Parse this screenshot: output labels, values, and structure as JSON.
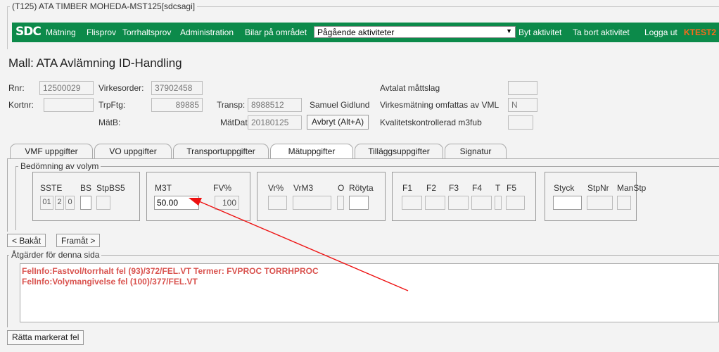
{
  "window": {
    "title": "(T125) ATA TIMBER MOHEDA-MST125[sdcsagi]"
  },
  "navbar": {
    "logo": "SDC",
    "items": [
      "Mätning",
      "Flisprov",
      "Torrhaltsprov",
      "Administration",
      "Bilar på området"
    ],
    "select_value": "Pågående aktiviteter",
    "actions": [
      "Byt aktivitet",
      "Ta bort aktivitet",
      "Logga ut"
    ],
    "user": "KTEST2",
    "colors": {
      "bar": "#0c8a4a",
      "user": "#ff6a1a"
    }
  },
  "page": {
    "title": "Mall: ATA Avlämning ID-Handling"
  },
  "header": {
    "rnr_label": "Rnr:",
    "rnr_value": "12500029",
    "virkesorder_label": "Virkesorder:",
    "virkesorder_value": "37902458",
    "avtalat_label": "Avtalat måttslag",
    "avtalat_value": "",
    "kortnr_label": "Kortnr:",
    "kortnr_value": "",
    "trpftg_label": "TrpFtg:",
    "trpftg_value": "89885",
    "transp_label": "Transp:",
    "transp_value": "8988512",
    "driver": "Samuel Gidlund",
    "vml_label": "Virkesmätning omfattas av VML",
    "vml_value": "N",
    "matb_label": "MätB:",
    "matdat_label": "MätDat",
    "matdat_value": "20180125",
    "abort_button": "Avbryt (Alt+A)",
    "kval_label": "Kvalitetskontrollerad m3fub",
    "kval_value": ""
  },
  "tabs": [
    {
      "label": "VMF uppgifter"
    },
    {
      "label": "VO uppgifter"
    },
    {
      "label": "Transportuppgifter"
    },
    {
      "label": "Mätuppgifter"
    },
    {
      "label": "Tilläggsuppgifter"
    },
    {
      "label": "Signatur"
    }
  ],
  "active_tab": "Mätuppgifter",
  "volume": {
    "group_title": "Bedömning av volym",
    "labels": {
      "sste": "SSTE",
      "bs": "BS",
      "stpbs5": "StpBS5",
      "m3t": "M3T",
      "fv": "FV%",
      "vr": "Vr%",
      "vrm3": "VrM3",
      "o": "O",
      "rotyta": "Rötyta",
      "f1": "F1",
      "f2": "F2",
      "f3": "F3",
      "f4": "F4",
      "t": "T",
      "f5": "F5",
      "styck": "Styck",
      "stpnr": "StpNr",
      "manstp": "ManStp"
    },
    "sste_values": [
      "01",
      "2",
      "0"
    ],
    "m3t_value": "50.00",
    "fv_value": "100"
  },
  "nav_buttons": {
    "back": "< Bakåt",
    "forward": "Framåt >"
  },
  "actions_section": {
    "title": "Åtgärder för denna sida",
    "messages": [
      "FelInfo:Fastvol/torrhalt fel (93)/372/FEL.VT Termer: FVPROC TORRHPROC",
      "FelInfo:Volymangivelse fel (100)/377/FEL.VT"
    ],
    "fix_button": "Rätta markerat fel",
    "message_color": "#d9534f"
  }
}
